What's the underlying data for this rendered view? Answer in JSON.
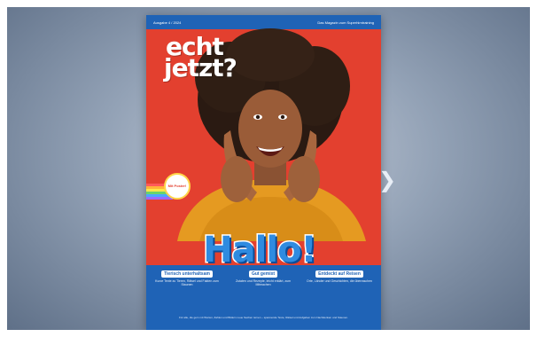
{
  "viewer": {
    "next_icon": "chevron-right-icon",
    "next_glyph": "❯"
  },
  "cover": {
    "issue": "Ausgabe 4 / 2024",
    "tagline": "Das Magazin zum Superhirntraining",
    "logo_line1": "echt",
    "logo_line2": "jetzt?",
    "badge_text": "Mit Poster!",
    "headline": "Hallo!",
    "columns": [
      {
        "title": "Tierisch unterhaltsam",
        "body": "Kurze Texte zu Tieren, Rätsel und Fakten zum Staunen"
      },
      {
        "title": "Gut gemixt",
        "body": "Zutaten und Rezepte, leicht erklärt, zum Mitmachen"
      },
      {
        "title": "Entdeckt auf Reisen",
        "body": "Orte, Länder und Geschichten, die überraschen"
      }
    ],
    "footer": "Für alle, die gern mit Worten, Zahlen und Bildern neue Sachen lernen – spannende Texte, Rätsel und Aufgaben zum Nachdenken und Staunen."
  }
}
